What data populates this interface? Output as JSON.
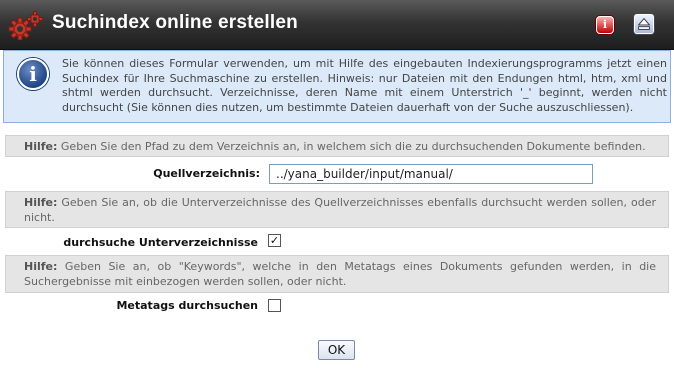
{
  "header": {
    "title": "Suchindex online erstellen",
    "info_icon": "info-icon",
    "up_icon": "eject-up-icon"
  },
  "notice": {
    "icon": "info-circle-icon",
    "text": "Sie können dieses Formular verwenden, um mit Hilfe des eingebauten Indexierungsprogramms jetzt einen Suchindex für Ihre Suchmaschine zu erstellen. Hinweis: nur Dateien mit den Endungen html, htm, xml und shtml werden durchsucht. Verzeichnisse, deren Name mit einem Unterstrich '_' beginnt, werden nicht durchsucht (Sie können dies nutzen, um bestimmte Dateien dauerhaft von der Suche auszuschliessen)."
  },
  "sections": {
    "source_dir": {
      "help_prefix": "Hilfe:",
      "help_text": "Geben Sie den Pfad zu dem Verzeichnis an, in welchem sich die zu durchsuchenden Dokumente befinden.",
      "label": "Quellverzeichnis:",
      "value": "../yana_builder/input/manual/"
    },
    "subdirs": {
      "help_prefix": "Hilfe:",
      "help_text": "Geben Sie an, ob die Unterverzeichnisse des Quellverzeichnisses ebenfalls durchsucht werden sollen, oder nicht.",
      "label": "durchsuche Unterverzeichnisse",
      "checked": true
    },
    "metatags": {
      "help_prefix": "Hilfe:",
      "help_text": "Geben Sie an, ob \"Keywords\", welche in den Metatags eines Dokuments gefunden werden, in die Suchergebnisse mit einbezogen werden sollen, oder nicht.",
      "label": "Metatags durchsuchen",
      "checked": false
    }
  },
  "ok_label": "OK",
  "colors": {
    "titlebar": "#333333",
    "notice_bg": "#dbe9f8",
    "help_bg": "#e5e5e5",
    "info_btn": "#c00000"
  }
}
